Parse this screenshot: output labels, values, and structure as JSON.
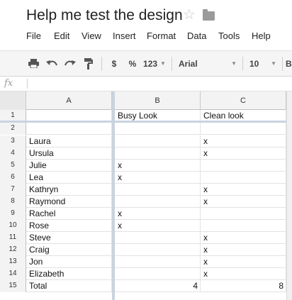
{
  "document": {
    "title": "Help me test the design",
    "star_icon": "star-icon",
    "folder_icon": "folder-icon"
  },
  "menu": [
    "File",
    "Edit",
    "View",
    "Insert",
    "Format",
    "Data",
    "Tools",
    "Help"
  ],
  "toolbar": {
    "print_icon": "print-icon",
    "undo_icon": "undo-icon",
    "redo_icon": "redo-icon",
    "paint_format_icon": "paint-format-icon",
    "currency": "$",
    "percent": "%",
    "more_formats": "123",
    "font": "Arial",
    "font_size": "10",
    "bold": "B"
  },
  "formula_bar": {
    "icon": "fx"
  },
  "columns": [
    "A",
    "B",
    "C"
  ],
  "rows": [
    {
      "n": "1",
      "a": "",
      "b": "Busy Look",
      "c": "Clean look"
    },
    {
      "n": "2",
      "a": "",
      "b": "",
      "c": ""
    },
    {
      "n": "3",
      "a": "Laura",
      "b": "",
      "c": "x"
    },
    {
      "n": "4",
      "a": "Ursula",
      "b": "",
      "c": "x"
    },
    {
      "n": "5",
      "a": "Julie",
      "b": "x",
      "c": ""
    },
    {
      "n": "6",
      "a": "Lea",
      "b": "x",
      "c": ""
    },
    {
      "n": "7",
      "a": "Kathryn",
      "b": "",
      "c": "x"
    },
    {
      "n": "8",
      "a": "Raymond",
      "b": "",
      "c": "x"
    },
    {
      "n": "9",
      "a": "Rachel",
      "b": "x",
      "c": ""
    },
    {
      "n": "10",
      "a": "Rose",
      "b": "x",
      "c": ""
    },
    {
      "n": "11",
      "a": "Steve",
      "b": "",
      "c": "x"
    },
    {
      "n": "12",
      "a": "Craig",
      "b": "",
      "c": "x"
    },
    {
      "n": "13",
      "a": "Jon",
      "b": "",
      "c": "x"
    },
    {
      "n": "14",
      "a": "Elizabeth",
      "b": "",
      "c": "x"
    },
    {
      "n": "15",
      "a": "Total",
      "b": "4",
      "c": "8"
    }
  ]
}
